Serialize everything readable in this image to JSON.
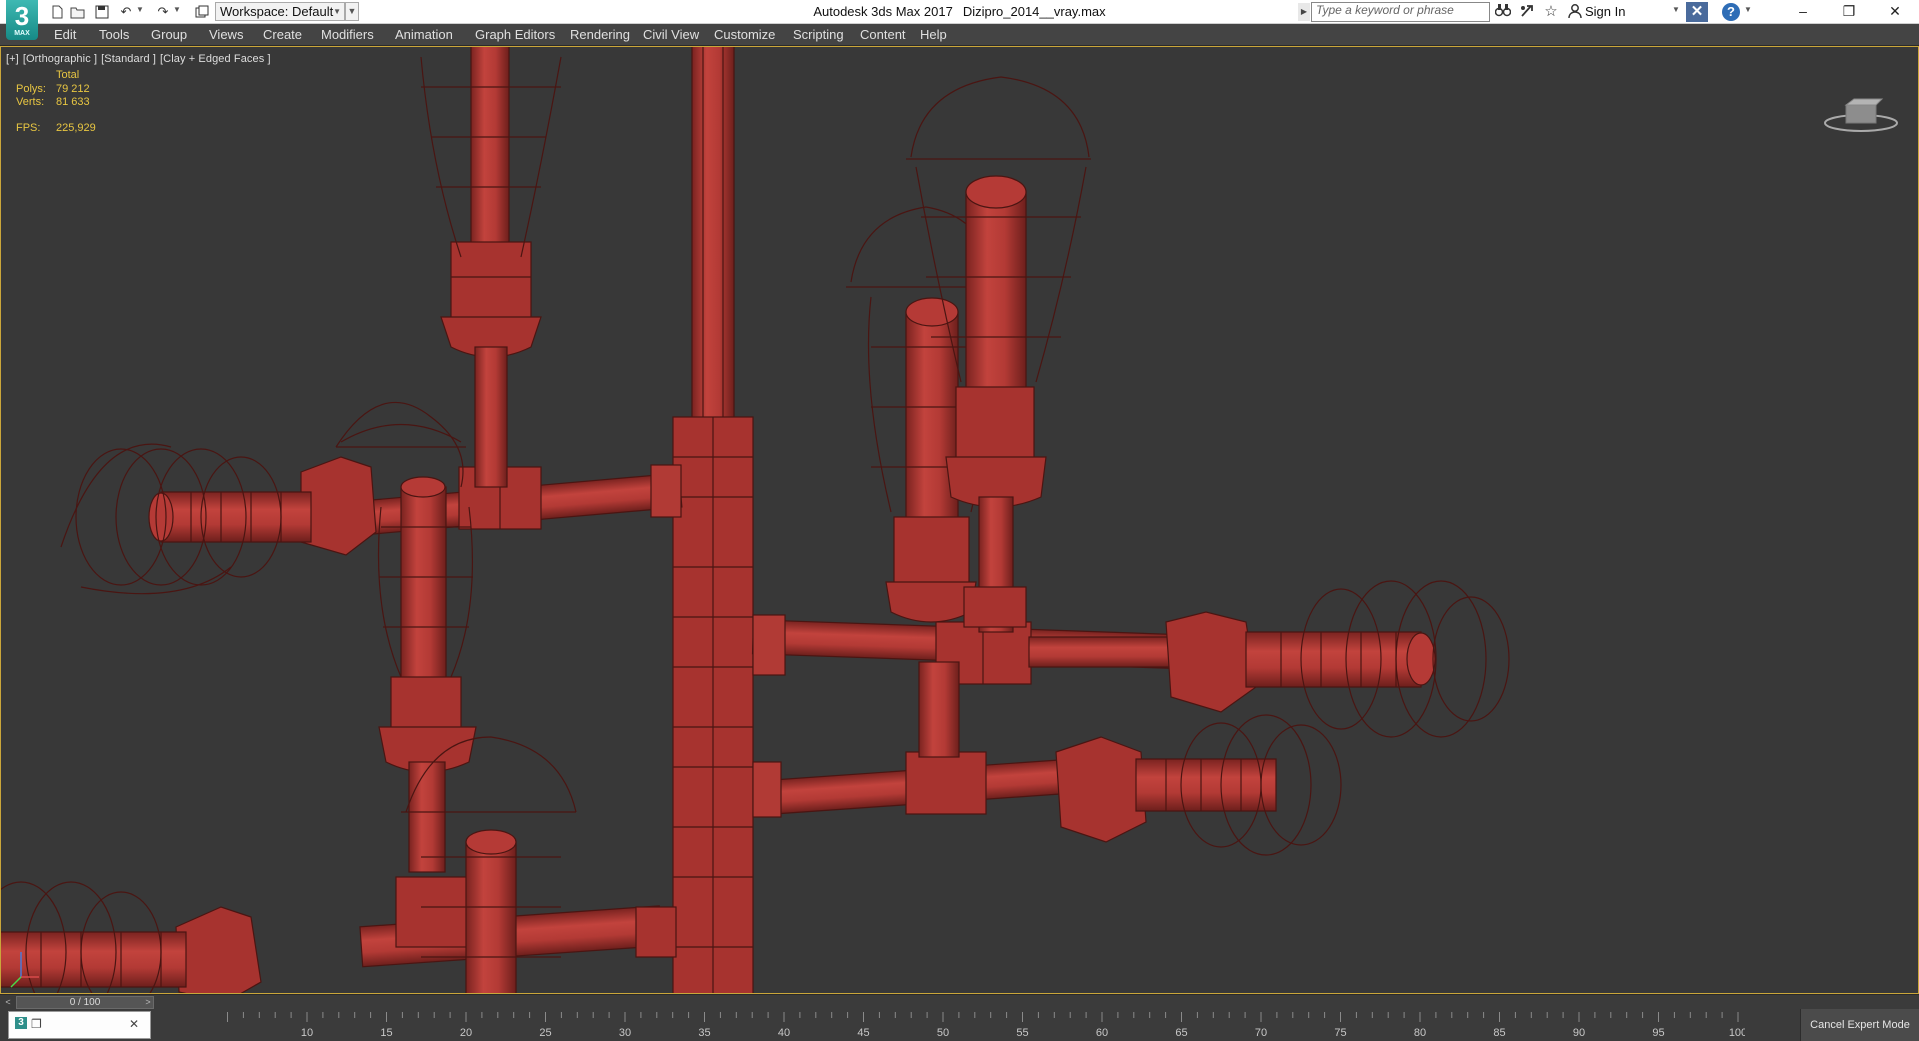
{
  "app": {
    "logo_text": "3",
    "logo_sub": "MAX",
    "title": "Autodesk 3ds Max 2017",
    "filename": "Dizipro_2014__vray.max"
  },
  "quick_access": {
    "workspace_label": "Workspace: Default",
    "icons": [
      "new-file-icon",
      "open-file-icon",
      "save-icon",
      "undo-icon",
      "redo-icon",
      "project-folder-icon"
    ]
  },
  "search": {
    "placeholder": "Type a keyword or phrase"
  },
  "infocenter": {
    "sign_in_label": "Sign In",
    "icons": [
      "binoculars-icon",
      "subscription-icon",
      "favorites-star-icon",
      "user-icon",
      "exchange-x-icon",
      "help-icon"
    ]
  },
  "window_controls": {
    "minimize": "–",
    "restore": "❐",
    "close": "✕"
  },
  "menu": {
    "items": [
      "Edit",
      "Tools",
      "Group",
      "Views",
      "Create",
      "Modifiers",
      "Animation",
      "Graph Editors",
      "Rendering",
      "Civil View",
      "Customize",
      "Scripting",
      "Content",
      "Help"
    ]
  },
  "viewport": {
    "label_plus": "[+]",
    "label_view": "[Orthographic ]",
    "label_shading": "[Standard ]",
    "label_style": "[Clay + Edged Faces ]",
    "stats": {
      "header": "Total",
      "polys_label": "Polys:",
      "polys_value": "79 212",
      "verts_label": "Verts:",
      "verts_value": "81 633",
      "fps_label": "FPS:",
      "fps_value": "225,929"
    },
    "model_color": "#b53a36",
    "wire_color": "#4a1512",
    "background_color": "#383838"
  },
  "timeslider": {
    "left_arrow": "<",
    "position_label": "0 / 100",
    "right_arrow": ">"
  },
  "trackbar": {
    "ticks": [
      "10",
      "15",
      "20",
      "25",
      "30",
      "35",
      "40",
      "45",
      "50",
      "55",
      "60",
      "65",
      "70",
      "75",
      "80",
      "85",
      "90",
      "95",
      "100"
    ],
    "cancel_expert_label": "Cancel Expert Mode"
  },
  "taskbar_mini": {
    "icons": [
      "max-icon",
      "restore-icon",
      "close-icon"
    ],
    "close_glyph": "✕"
  }
}
